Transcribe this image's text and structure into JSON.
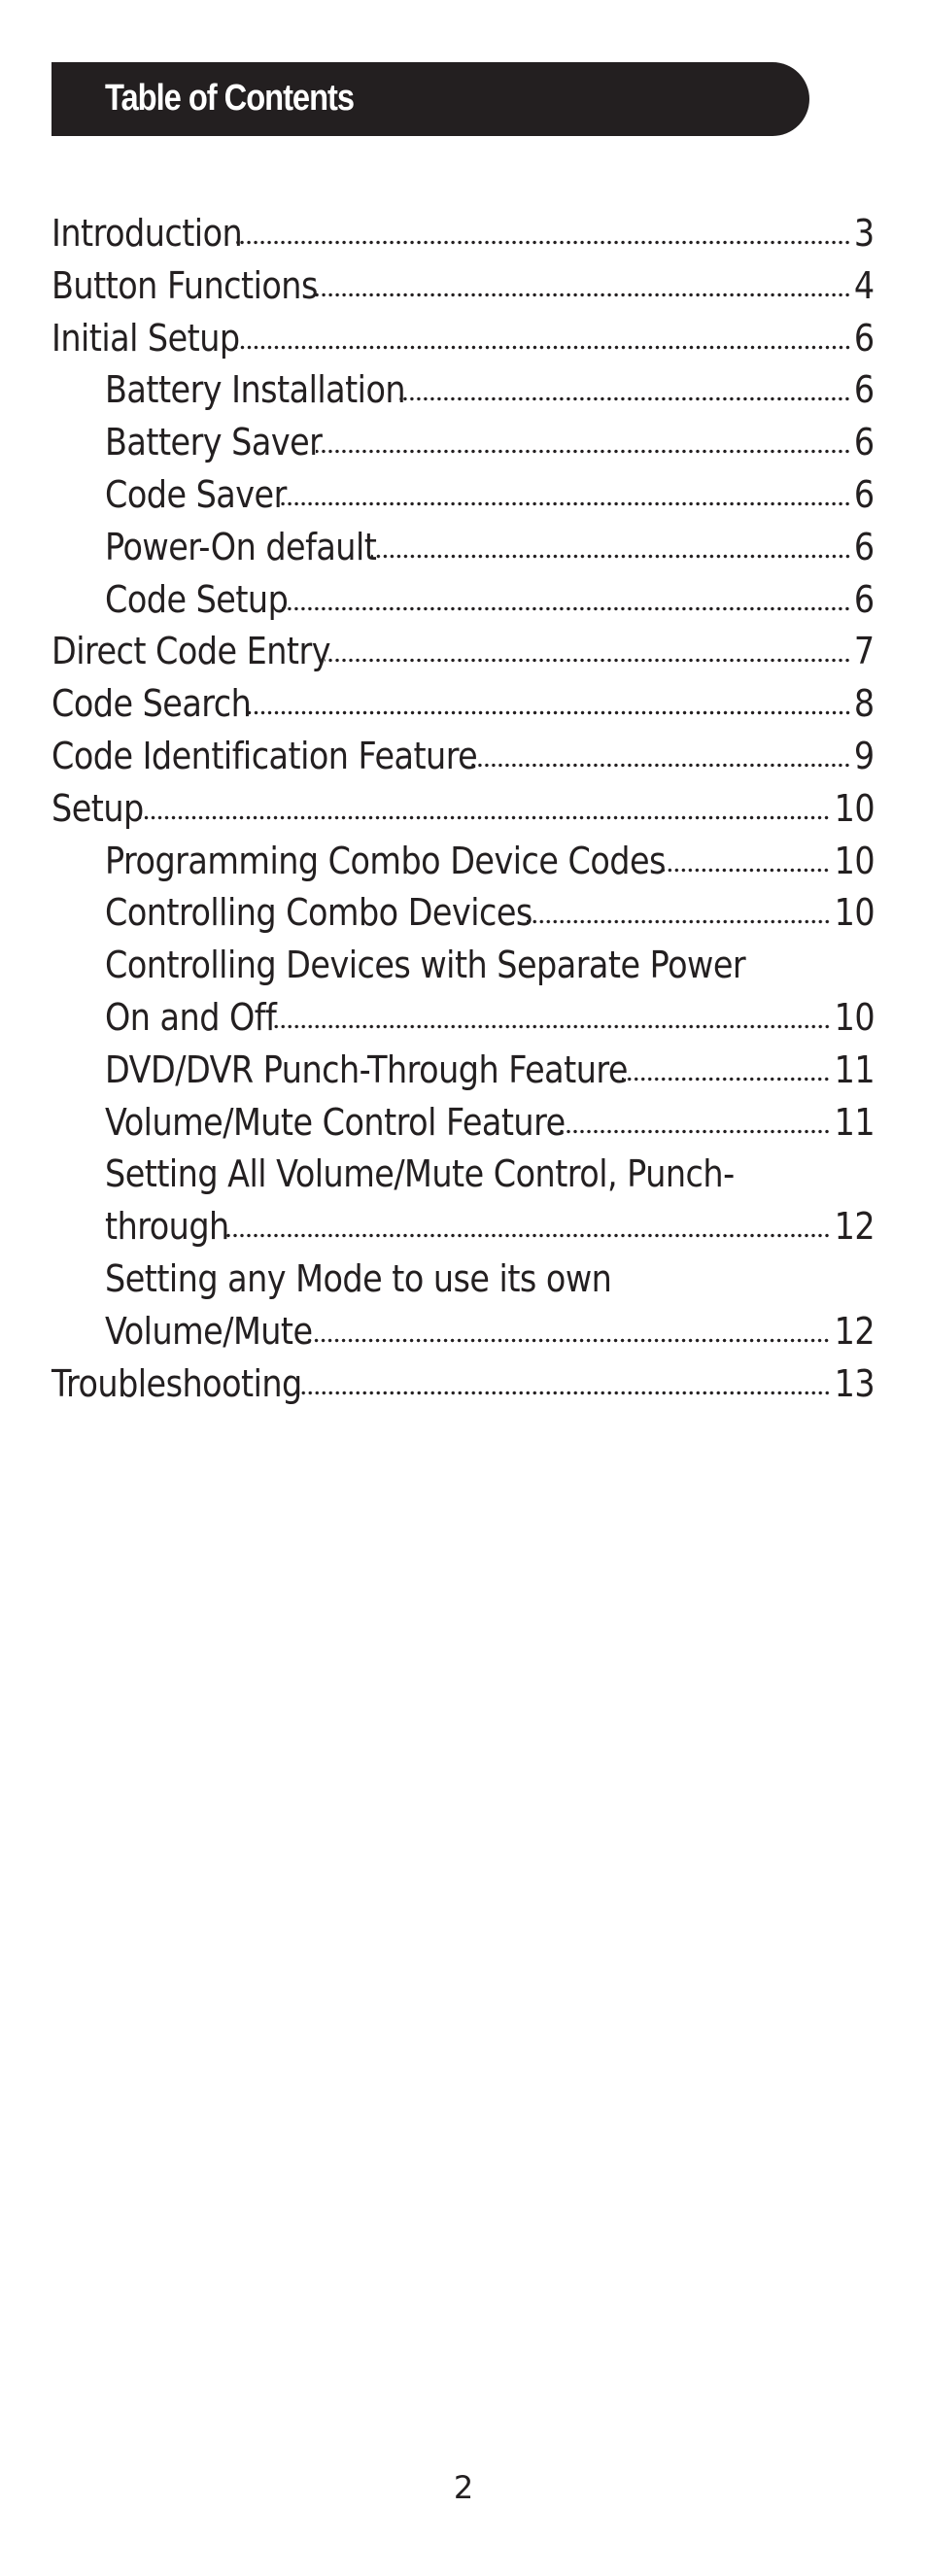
{
  "header": {
    "title": "Table of Contents",
    "bar_color": "#231f20"
  },
  "toc": {
    "entries": [
      {
        "level": 1,
        "lines": [
          "Introduction"
        ],
        "page": "3"
      },
      {
        "level": 1,
        "lines": [
          "Button Functions"
        ],
        "page": "4"
      },
      {
        "level": 1,
        "lines": [
          "Initial Setup"
        ],
        "page": "6"
      },
      {
        "level": 2,
        "lines": [
          "Battery Installation"
        ],
        "page": "6"
      },
      {
        "level": 2,
        "lines": [
          "Battery Saver"
        ],
        "page": "6"
      },
      {
        "level": 2,
        "lines": [
          "Code Saver"
        ],
        "page": "6"
      },
      {
        "level": 2,
        "lines": [
          "Power-On default"
        ],
        "page": "6"
      },
      {
        "level": 2,
        "lines": [
          "Code Setup"
        ],
        "page": "6"
      },
      {
        "level": 1,
        "lines": [
          "Direct Code Entry"
        ],
        "page": "7"
      },
      {
        "level": 1,
        "lines": [
          "Code Search"
        ],
        "page": "8"
      },
      {
        "level": 1,
        "lines": [
          "Code Identification Feature"
        ],
        "page": "9"
      },
      {
        "level": 1,
        "lines": [
          "Setup"
        ],
        "page": "10"
      },
      {
        "level": 2,
        "lines": [
          "Programming Combo Device Codes"
        ],
        "page": "10"
      },
      {
        "level": 2,
        "lines": [
          "Controlling Combo Devices"
        ],
        "page": "10"
      },
      {
        "level": 2,
        "lines": [
          "Controlling Devices with Separate Power",
          "On and Off"
        ],
        "page": "10"
      },
      {
        "level": 2,
        "lines": [
          "DVD/DVR Punch-Through Feature"
        ],
        "page": "11"
      },
      {
        "level": 2,
        "lines": [
          "Volume/Mute Control Feature"
        ],
        "page": "11"
      },
      {
        "level": 2,
        "lines": [
          "Setting All Volume/Mute Control, Punch-",
          "through"
        ],
        "page": "12"
      },
      {
        "level": 2,
        "lines": [
          "Setting any Mode to use its own",
          "Volume/Mute"
        ],
        "page": "12"
      },
      {
        "level": 1,
        "lines": [
          "Troubleshooting"
        ],
        "page": "13"
      }
    ]
  },
  "footer": {
    "page_number": "2"
  }
}
